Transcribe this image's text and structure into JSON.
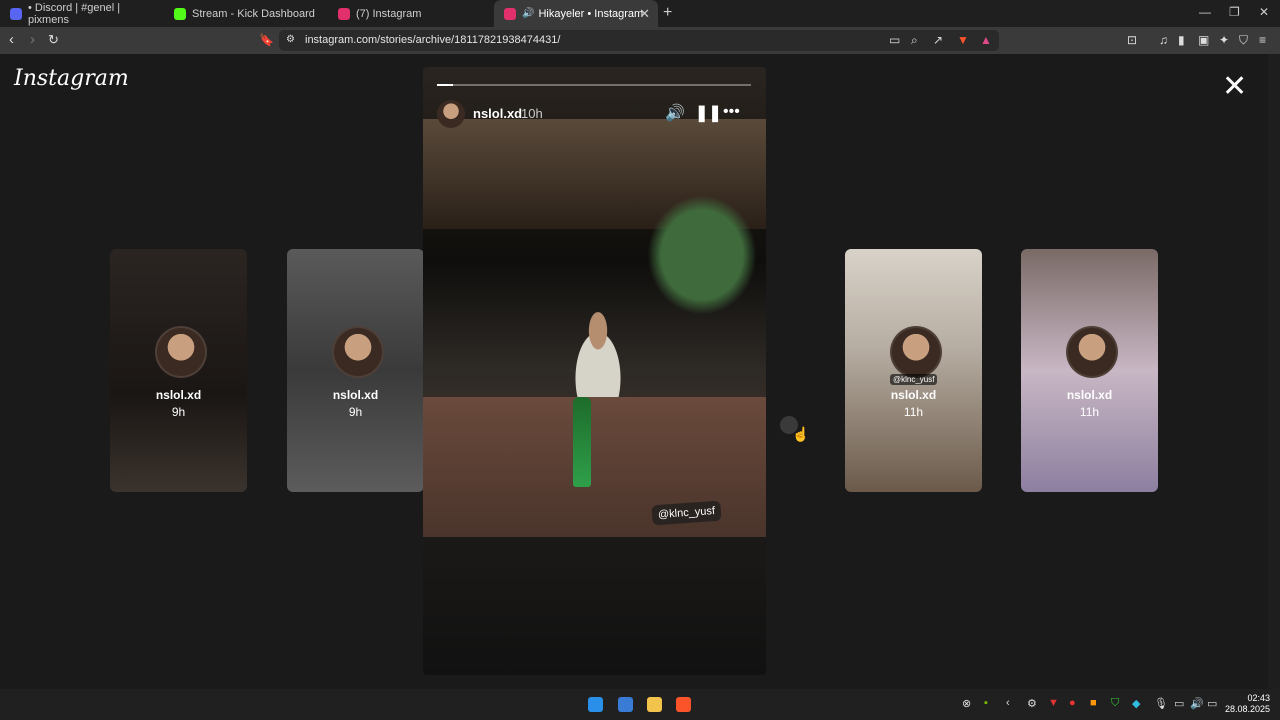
{
  "tabs": [
    {
      "label": "• Discord | #genel | pixmens",
      "favicon": "discord-icon",
      "color": "#5865F2"
    },
    {
      "label": "Stream - Kick Dashboard",
      "favicon": "kick-icon",
      "color": "#53FC18"
    },
    {
      "label": "(7) Instagram",
      "favicon": "instagram-icon",
      "color": "#E1306C"
    },
    {
      "label": "Hikayeler • Instagram",
      "favicon": "instagram-icon",
      "color": "#E1306C",
      "active": true
    }
  ],
  "address_bar": {
    "url": "instagram.com/stories/archive/18117821938474431/"
  },
  "page": {
    "logo": "Instagram",
    "close_icon": "close-icon",
    "stories_left": [
      {
        "user": "nslol.xd",
        "time": "9h"
      },
      {
        "user": "nslol.xd",
        "time": "9h"
      }
    ],
    "current_story": {
      "user": "nslol.xd",
      "time": "10h",
      "progress": 0.05,
      "mention": "@klnc_yusf"
    },
    "stories_right": [
      {
        "user": "nslol.xd",
        "time": "11h",
        "mention": "@klnc_yusf"
      },
      {
        "user": "nslol.xd",
        "time": "11h"
      }
    ]
  },
  "taskbar": {
    "time": "02:43",
    "date": "28.08.2025"
  }
}
